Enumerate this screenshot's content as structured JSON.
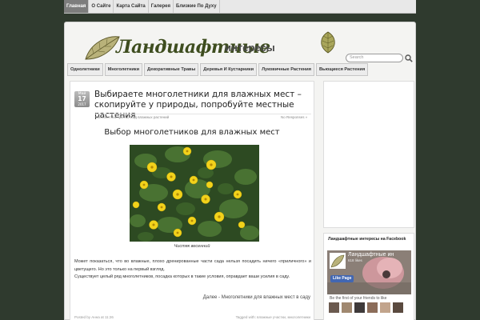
{
  "top_nav": [
    "Главная",
    "О Сайте",
    "Карта Сайта",
    "Галерея",
    "Близкие По Духу"
  ],
  "header": {
    "logo_script": "Ландшафтные",
    "logo_text": "интересы",
    "search_placeholder": "Search"
  },
  "category_nav": [
    "Однолетники",
    "Многолетники",
    "Декоративные Травы",
    "Деревья И Кустарники",
    "Луковичные Растения",
    "Вьющиеся Растения"
  ],
  "post": {
    "date": {
      "month": "Май",
      "day": "17",
      "year": "2017"
    },
    "title": "Выбираете многолетники для влажных мест – скопируйте у природы, попробуйте местные растения",
    "categories": "Многолетние цветы, Сад влажных растений",
    "comments": "No Responses »",
    "subtitle": "Выбор многолетников для влажных мест",
    "photo_caption": "Чистяк весенний",
    "paragraph1": "Может показаться, что во влажные, плохо дренированные части сада нельзя посадить ничего «приличного» и цветущего. Но это только на первый взгляд.",
    "paragraph2": "Существует целый ряд многолетников, посадка которых в такие условия, оправдает ваши усилия в саду.",
    "read_more": "Далее - Многолетники для влажных мест в саду",
    "footer_left": "Posted by Анна at 11:26",
    "footer_right": "Tagged with: влажные участки, многолетники"
  },
  "sidebar": {
    "widget_title": "Ландшафтные интересы на Facebook",
    "fb_page_name": "Ландшафтные ин",
    "fb_likes": "618 likes",
    "fb_like_button": "Like Page",
    "fb_friends_text": "Be the first of your friends to like"
  },
  "colors": {
    "background": "#2f3a2e",
    "logo_green": "#3e4d1f",
    "active_tab": "#7d7d7d",
    "facebook_blue": "#4267b2"
  }
}
